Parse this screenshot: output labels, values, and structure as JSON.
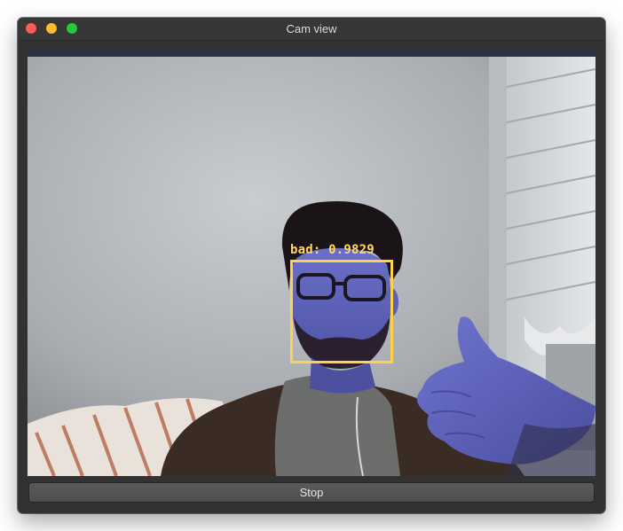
{
  "window": {
    "title": "Cam view",
    "controls": [
      "close",
      "minimize",
      "zoom"
    ]
  },
  "video": {
    "detection": {
      "label": "bad: 0.9829",
      "box_color": "#ffd24a"
    }
  },
  "controls": {
    "stop_label": "Stop"
  }
}
